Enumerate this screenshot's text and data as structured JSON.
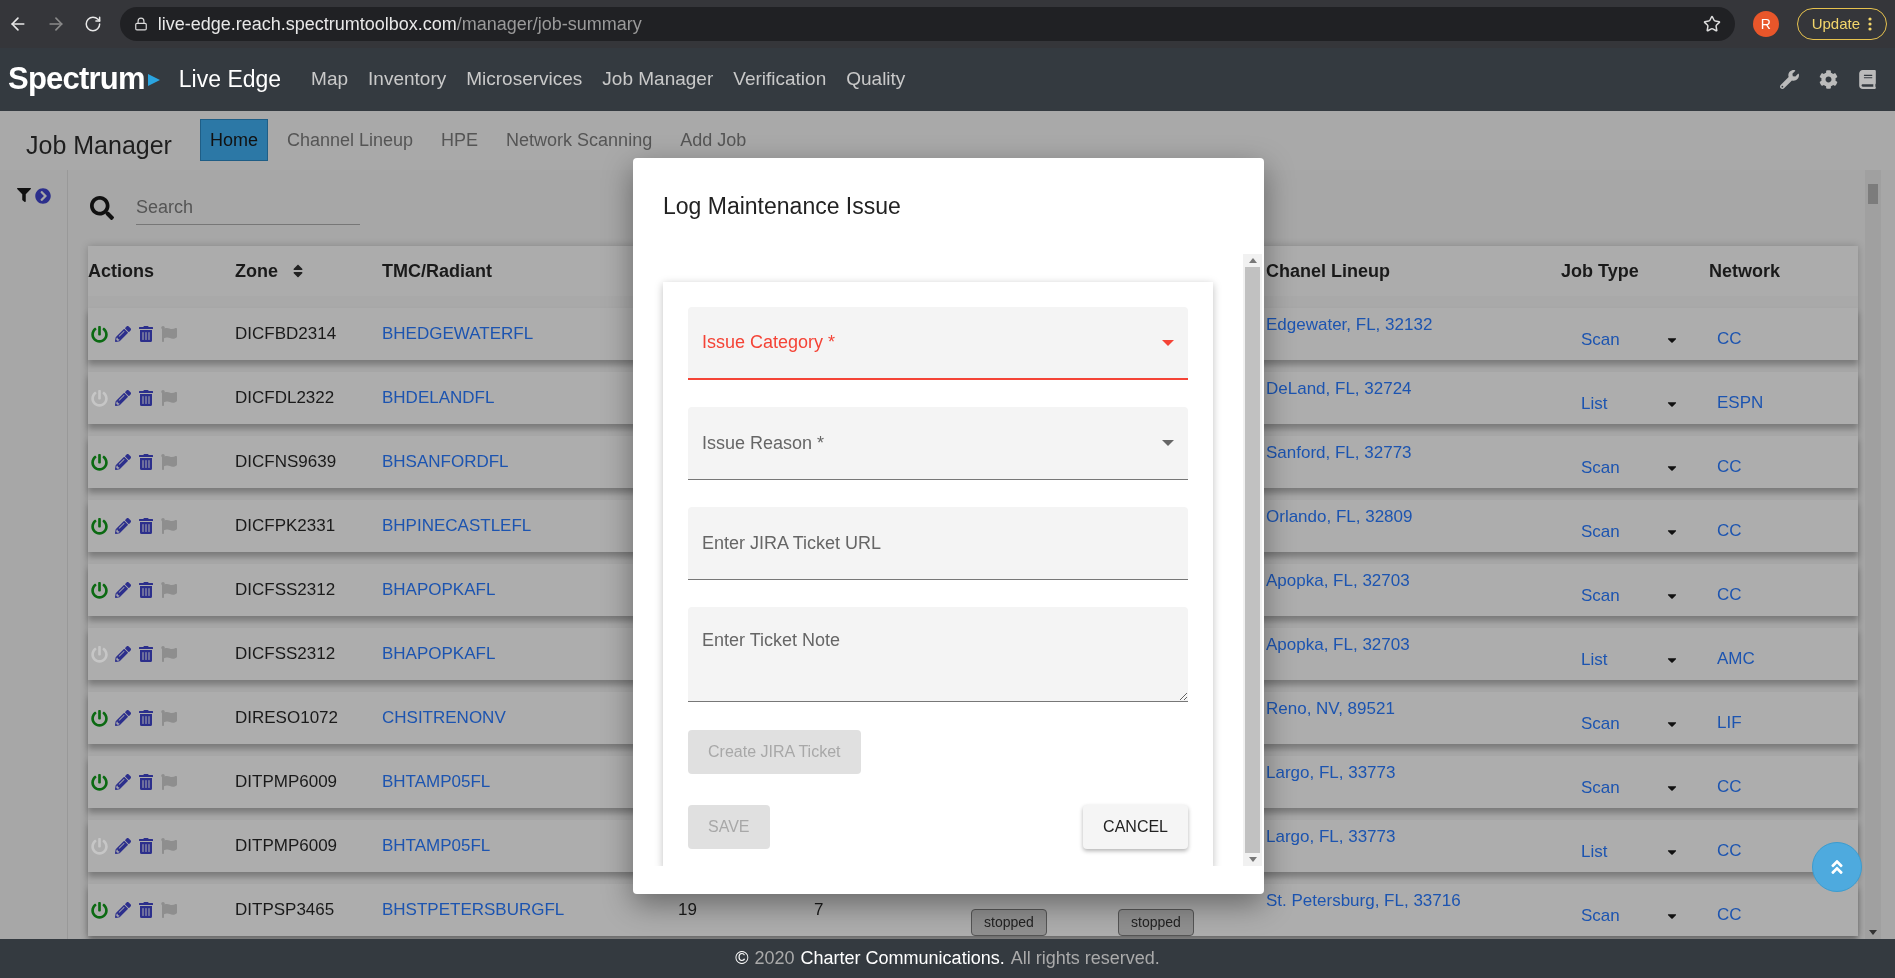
{
  "browser": {
    "url_host": "live-edge.reach.spectrumtoolbox.com",
    "url_path": "/manager/job-summary",
    "avatar_initial": "R",
    "update_label": "Update"
  },
  "navbar": {
    "brand": "Spectrum",
    "app_name": "Live Edge",
    "menu": [
      "Map",
      "Inventory",
      "Microservices",
      "Job Manager",
      "Verification",
      "Quality"
    ]
  },
  "subnav": {
    "title": "Job Manager",
    "tabs": [
      {
        "label": "Home",
        "selected": true
      },
      {
        "label": "Channel Lineup",
        "selected": false
      },
      {
        "label": "HPE",
        "selected": false
      },
      {
        "label": "Network Scanning",
        "selected": false
      },
      {
        "label": "Add Job",
        "selected": false
      }
    ]
  },
  "search": {
    "placeholder": "Search"
  },
  "table": {
    "columns_left": [
      {
        "label": "Actions",
        "sortable": false
      },
      {
        "label": "Zone",
        "sortable": true
      },
      {
        "label": "TMC/Radiant",
        "sortable": false
      }
    ],
    "columns_right": [
      {
        "label": "Chanel Lineup",
        "sortable": false
      },
      {
        "label": "Job Type",
        "sortable": false
      },
      {
        "label": "Network",
        "sortable": false
      }
    ],
    "rows": [
      {
        "power_on": true,
        "zone": "DICFBD2314",
        "tmc": "BHEDGEWATERFL",
        "lineup": "Edgewater, FL, 32132",
        "job_type": "Scan",
        "network": "CC"
      },
      {
        "power_on": false,
        "zone": "DICFDL2322",
        "tmc": "BHDELANDFL",
        "lineup": "DeLand, FL, 32724",
        "job_type": "List",
        "network": "ESPN"
      },
      {
        "power_on": true,
        "zone": "DICFNS9639",
        "tmc": "BHSANFORDFL",
        "lineup": "Sanford, FL, 32773",
        "job_type": "Scan",
        "network": "CC"
      },
      {
        "power_on": true,
        "zone": "DICFPK2331",
        "tmc": "BHPINECASTLEFL",
        "lineup": "Orlando, FL, 32809",
        "job_type": "Scan",
        "network": "CC"
      },
      {
        "power_on": true,
        "zone": "DICFSS2312",
        "tmc": "BHAPOPKAFL",
        "lineup": "Apopka, FL, 32703",
        "job_type": "Scan",
        "network": "CC"
      },
      {
        "power_on": false,
        "zone": "DICFSS2312",
        "tmc": "BHAPOPKAFL",
        "lineup": "Apopka, FL, 32703",
        "job_type": "List",
        "network": "AMC"
      },
      {
        "power_on": true,
        "zone": "DIRESO1072",
        "tmc": "CHSITRENONV",
        "lineup": "Reno, NV, 89521",
        "job_type": "Scan",
        "network": "LIF"
      },
      {
        "power_on": true,
        "zone": "DITPMP6009",
        "tmc": "BHTAMP05FL",
        "lineup": "Largo, FL, 33773",
        "job_type": "Scan",
        "network": "CC"
      },
      {
        "power_on": false,
        "zone": "DITPMP6009",
        "tmc": "BHTAMP05FL",
        "lineup": "Largo, FL, 33773",
        "job_type": "List",
        "network": "CC"
      },
      {
        "power_on": true,
        "zone": "DITPSP3465",
        "tmc": "BHSTPETERSBURGFL",
        "column_4": "19",
        "column_5": "7",
        "column_6": "stopped",
        "column_7": "stopped",
        "lineup": "St. Petersburg, FL, 33716",
        "job_type": "Scan",
        "network": "CC"
      }
    ]
  },
  "modal": {
    "title": "Log Maintenance Issue",
    "fields": [
      {
        "kind": "select",
        "label": "Issue Category *",
        "error": true
      },
      {
        "kind": "select",
        "label": "Issue Reason *",
        "error": false
      },
      {
        "kind": "input",
        "placeholder": "Enter JIRA Ticket URL",
        "error": false
      },
      {
        "kind": "textarea",
        "placeholder": "Enter Ticket Note",
        "error": false
      }
    ],
    "create_button": {
      "label": "Create JIRA Ticket",
      "disabled": true
    },
    "save_button": {
      "label": "SAVE",
      "disabled": true
    },
    "cancel_button": {
      "label": "CANCEL",
      "disabled": false
    }
  },
  "footer": {
    "symbol": "©",
    "year": "2020",
    "company": "Charter Communications.",
    "rights": "All rights reserved."
  }
}
